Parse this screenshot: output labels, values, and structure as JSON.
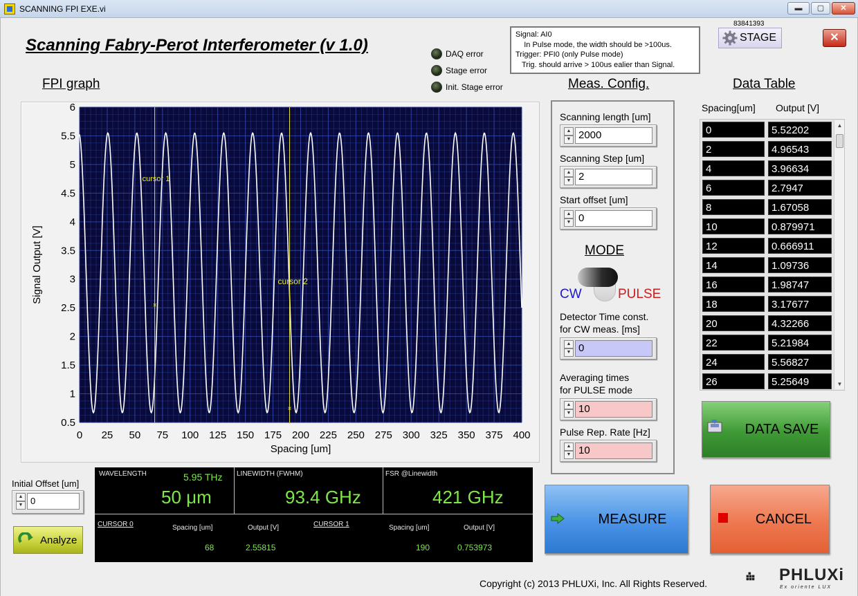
{
  "window": {
    "title": "SCANNING FPI EXE.vi",
    "min": "▬",
    "max": "▢",
    "close": "✕"
  },
  "header": {
    "title": "Scanning Fabry-Perot Interferometer (v 1.0)",
    "indicators": [
      "DAQ error",
      "Stage error",
      "Init. Stage error"
    ],
    "info_lines": [
      "Signal: AI0",
      "    In Pulse mode, the width should be >100us.",
      "Trigger: PFI0 (only Pulse mode)",
      "   Trig. should arrive > 100us ealier than Signal."
    ],
    "stage_code": "83841393",
    "stage_label": "STAGE",
    "close_label": "✕"
  },
  "graph": {
    "title": "FPI graph",
    "cursor1_label": "cursor 1",
    "cursor2_label": "cursor 2"
  },
  "chart_data": {
    "type": "line",
    "xlabel": "Spacing [um]",
    "ylabel": "Signal Output [V]",
    "xlim": [
      0,
      400
    ],
    "ylim": [
      0.5,
      6
    ],
    "x_ticks": [
      "0",
      "25",
      "50",
      "75",
      "100",
      "125",
      "150",
      "175",
      "200",
      "225",
      "250",
      "275",
      "300",
      "325",
      "350",
      "375",
      "400"
    ],
    "y_ticks": [
      "0.5",
      "1",
      "1.5",
      "2",
      "2.5",
      "3",
      "3.5",
      "4",
      "4.5",
      "5",
      "5.5",
      "6"
    ],
    "series": [
      {
        "period_um": 26.2,
        "min": 0.67,
        "max": 5.55,
        "first_peak_x": 25.6,
        "color": "#ffffff"
      }
    ],
    "cursors": [
      {
        "x": 68,
        "y": 2.55815,
        "color": "#e6e640"
      },
      {
        "x": 190,
        "y": 0.753973,
        "color": "#e6e640"
      }
    ],
    "grid": true
  },
  "config": {
    "title": "Meas. Config.",
    "scanning_length_label": "Scanning length [um]",
    "scanning_length": "2000",
    "scanning_step_label": "Scanning Step [um]",
    "scanning_step": "2",
    "start_offset_label": "Start offset [um]",
    "start_offset": "0",
    "mode_title": "MODE",
    "mode_cw": "CW",
    "mode_pulse": "PULSE",
    "detector_label_1": "Detector Time const.",
    "detector_label_2": "for CW meas. [ms]",
    "detector_value": "0",
    "averaging_label_1": "Averaging times",
    "averaging_label_2": "for PULSE mode",
    "averaging_value": "10",
    "rep_rate_label": "Pulse Rep. Rate [Hz]",
    "rep_rate_value": "10",
    "spin_up": "▲",
    "spin_down": "▼"
  },
  "table": {
    "title": "Data Table",
    "col1": "Spacing[um]",
    "col2": "Output [V]",
    "rows": [
      [
        "0",
        "5.52202"
      ],
      [
        "2",
        "4.96543"
      ],
      [
        "4",
        "3.96634"
      ],
      [
        "6",
        "2.7947"
      ],
      [
        "8",
        "1.67058"
      ],
      [
        "10",
        "0.879971"
      ],
      [
        "12",
        "0.666911"
      ],
      [
        "14",
        "1.09736"
      ],
      [
        "16",
        "1.98747"
      ],
      [
        "18",
        "3.17677"
      ],
      [
        "20",
        "4.32266"
      ],
      [
        "22",
        "5.21984"
      ],
      [
        "24",
        "5.56827"
      ],
      [
        "26",
        "5.25649"
      ]
    ],
    "scroll_up": "▲",
    "scroll_down": "▼"
  },
  "buttons": {
    "data_save": "DATA SAVE",
    "measure": "MEASURE",
    "cancel": "CANCEL",
    "analyze": "Analyze"
  },
  "offset": {
    "label": "Initial Offset [um]",
    "value": "0"
  },
  "results": {
    "wavelength_label": "WAVELENGTH",
    "frequency": "5.95 THz",
    "wavelength": "50 μm",
    "linewidth_label": "LINEWIDTH (FWHM)",
    "linewidth": "93.4 GHz",
    "fsr_label": "FSR @Linewidth",
    "fsr": "421 GHz",
    "cursor0_label": "CURSOR 0",
    "cursor1_label": "CURSOR 1",
    "spacing_label": "Spacing [um]",
    "output_label": "Output [V]",
    "c0_spacing": "68",
    "c0_output": "2.55815",
    "c1_spacing": "190",
    "c1_output": "0.753973"
  },
  "footer": {
    "copyright": "Copyright (c) 2013 PHLUXi, Inc. All Rights Reserved.",
    "logo_text": "PHLUXi",
    "logo_tagline": "Ex oriente LUX"
  }
}
